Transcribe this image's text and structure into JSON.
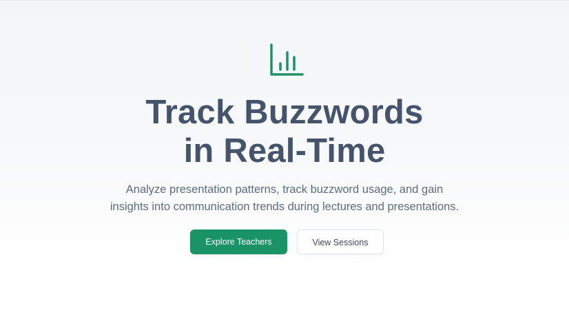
{
  "hero": {
    "icon": "bar-chart-icon",
    "accent_color": "#1a9367",
    "headline_line1": "Track Buzzwords",
    "headline_line2": "in Real-Time",
    "subtitle_line1": "Analyze presentation patterns, track buzzword usage, and gain",
    "subtitle_line2": "insights into communication trends during lectures and presentations.",
    "primary_button_label": "Explore Teachers",
    "secondary_button_label": "View Sessions"
  }
}
